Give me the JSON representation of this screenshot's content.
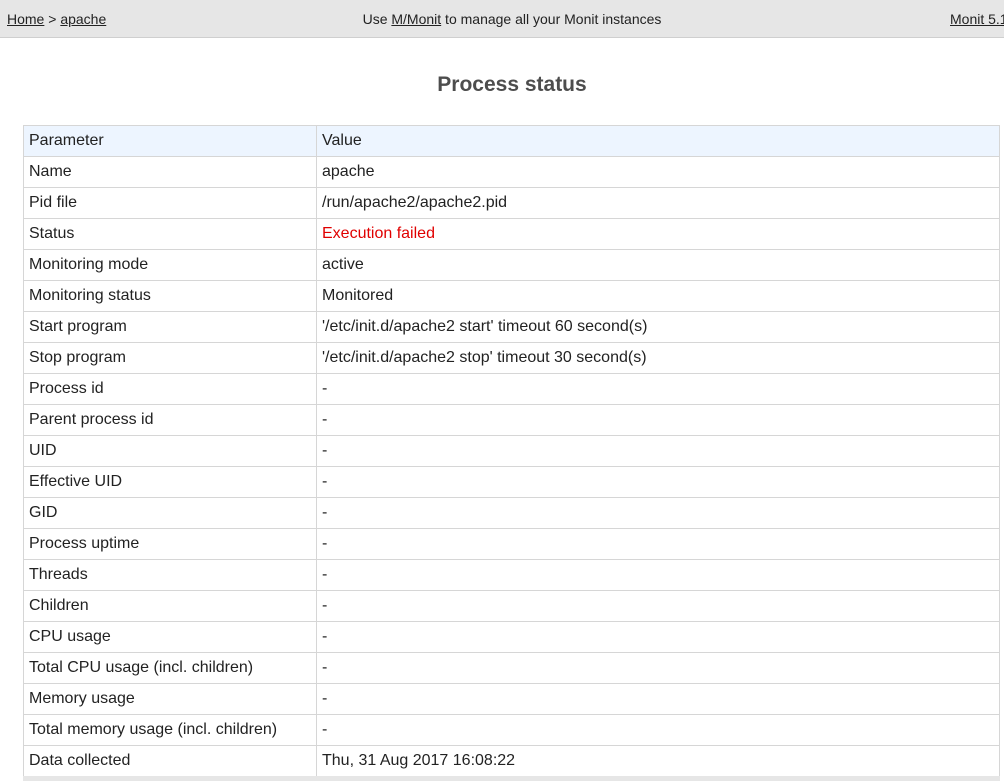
{
  "header": {
    "breadcrumb_home": "Home",
    "breadcrumb_separator": " > ",
    "breadcrumb_current": "apache",
    "message_prefix": "Use ",
    "message_link": "M/Monit",
    "message_suffix": " to manage all your Monit instances",
    "version": "Monit 5.1"
  },
  "page_title": "Process status",
  "table": {
    "col_parameter": "Parameter",
    "col_value": "Value",
    "rows": [
      {
        "param": "Name",
        "value": "apache"
      },
      {
        "param": "Pid file",
        "value": "/run/apache2/apache2.pid"
      },
      {
        "param": "Status",
        "value": "Execution failed"
      },
      {
        "param": "Monitoring mode",
        "value": "active"
      },
      {
        "param": "Monitoring status",
        "value": "Monitored"
      },
      {
        "param": "Start program",
        "value": "'/etc/init.d/apache2 start' timeout 60 second(s)"
      },
      {
        "param": "Stop program",
        "value": "'/etc/init.d/apache2 stop' timeout 30 second(s)"
      },
      {
        "param": "Process id",
        "value": "-"
      },
      {
        "param": "Parent process id",
        "value": "-"
      },
      {
        "param": "UID",
        "value": "-"
      },
      {
        "param": "Effective UID",
        "value": "-"
      },
      {
        "param": "GID",
        "value": "-"
      },
      {
        "param": "Process uptime",
        "value": "-"
      },
      {
        "param": "Threads",
        "value": "-"
      },
      {
        "param": "Children",
        "value": "-"
      },
      {
        "param": "CPU usage",
        "value": "-"
      },
      {
        "param": "Total CPU usage (incl. children)",
        "value": "-"
      },
      {
        "param": "Memory usage",
        "value": "-"
      },
      {
        "param": "Total memory usage (incl. children)",
        "value": "-"
      },
      {
        "param": "Data collected",
        "value": "Thu, 31 Aug 2017 16:08:22"
      }
    ]
  },
  "colors": {
    "status_failed": "#e00000",
    "header_bg": "#e6e6e6",
    "table_head_bg": "#edf5ff"
  }
}
